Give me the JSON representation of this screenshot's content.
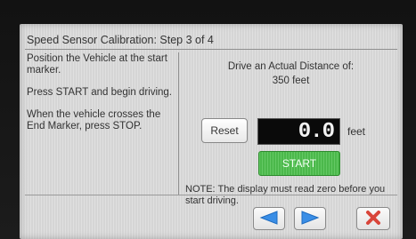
{
  "header": {
    "title": "Speed Sensor Calibration:  Step 3 of 4"
  },
  "instructions": [
    "Position the Vehicle at the start marker.",
    "Press START and begin driving.",
    "When the vehicle crosses the End Marker, press STOP."
  ],
  "calibration": {
    "drive_label": "Drive an Actual Distance of:",
    "distance": "350 feet",
    "reset_label": "Reset",
    "display_value": "0.0",
    "unit": "feet",
    "start_label": "START",
    "note": "NOTE:  The display must read zero before you start driving."
  },
  "nav": {
    "prev_icon": "arrow-left-icon",
    "next_icon": "arrow-right-icon",
    "close_icon": "close-icon"
  },
  "colors": {
    "screen_bg": "#dcdcdc",
    "start_green": "#4fc24f",
    "nav_arrow_blue": "#3a8ee6",
    "close_red": "#d9453a",
    "display_bg": "#0a0a0a"
  }
}
